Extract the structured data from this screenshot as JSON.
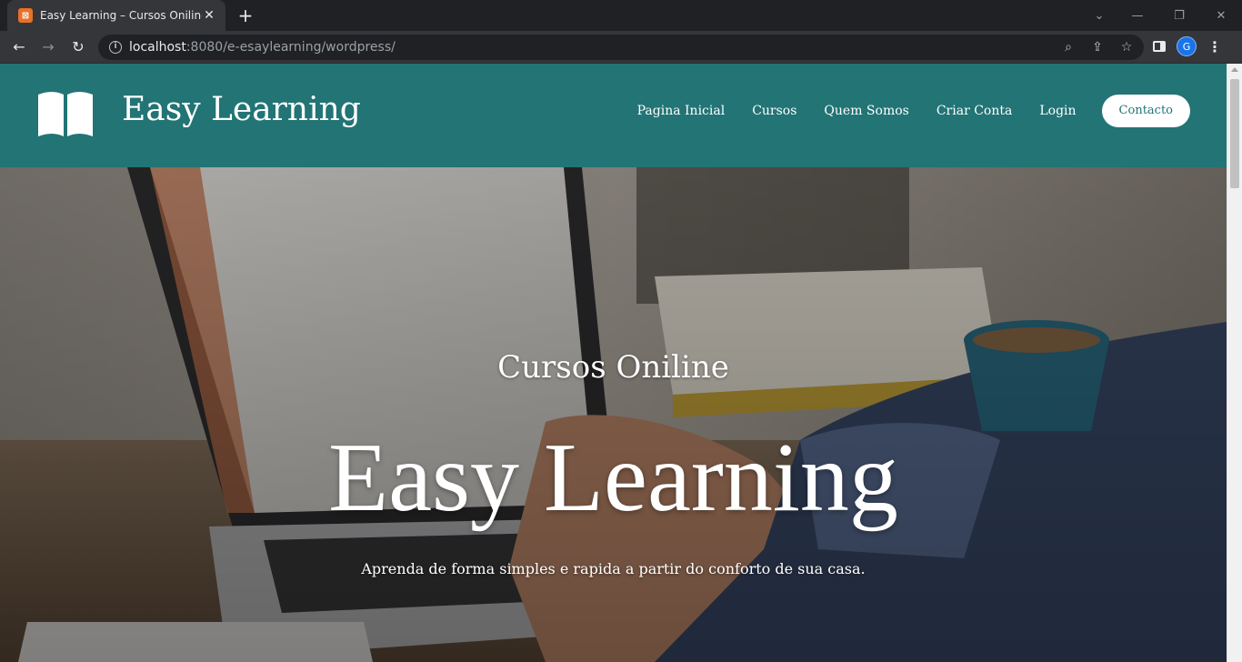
{
  "browser": {
    "tab": {
      "title": "Easy Learning – Cursos Oniline",
      "close": "✕",
      "favicon": "xampp-icon"
    },
    "new_tab": "+",
    "window_controls": {
      "dropdown": "⌄",
      "minimize": "—",
      "restore": "❐",
      "close": "✕"
    },
    "nav": {
      "back": "←",
      "forward": "→",
      "reload": "↻"
    },
    "url": {
      "host": "localhost",
      "path": ":8080/e-esaylearning/wordpress/"
    },
    "omnibox_icons": {
      "zoom": "⌕",
      "share": "⇪",
      "bookmark": "☆"
    },
    "profile_initial": "G",
    "menu": "⋮"
  },
  "site": {
    "title": "Easy Learning",
    "brand_color": "#227475",
    "nav": [
      {
        "label": "Pagina Inicial"
      },
      {
        "label": "Cursos"
      },
      {
        "label": "Quem Somos"
      },
      {
        "label": "Criar Conta"
      },
      {
        "label": "Login"
      }
    ],
    "cta": "Contacto"
  },
  "hero": {
    "pre_title": "Cursos Oniline",
    "title": "Easy Learning",
    "subtitle": "Aprenda de forma simples e rapida a partir do conforto de sua casa."
  }
}
